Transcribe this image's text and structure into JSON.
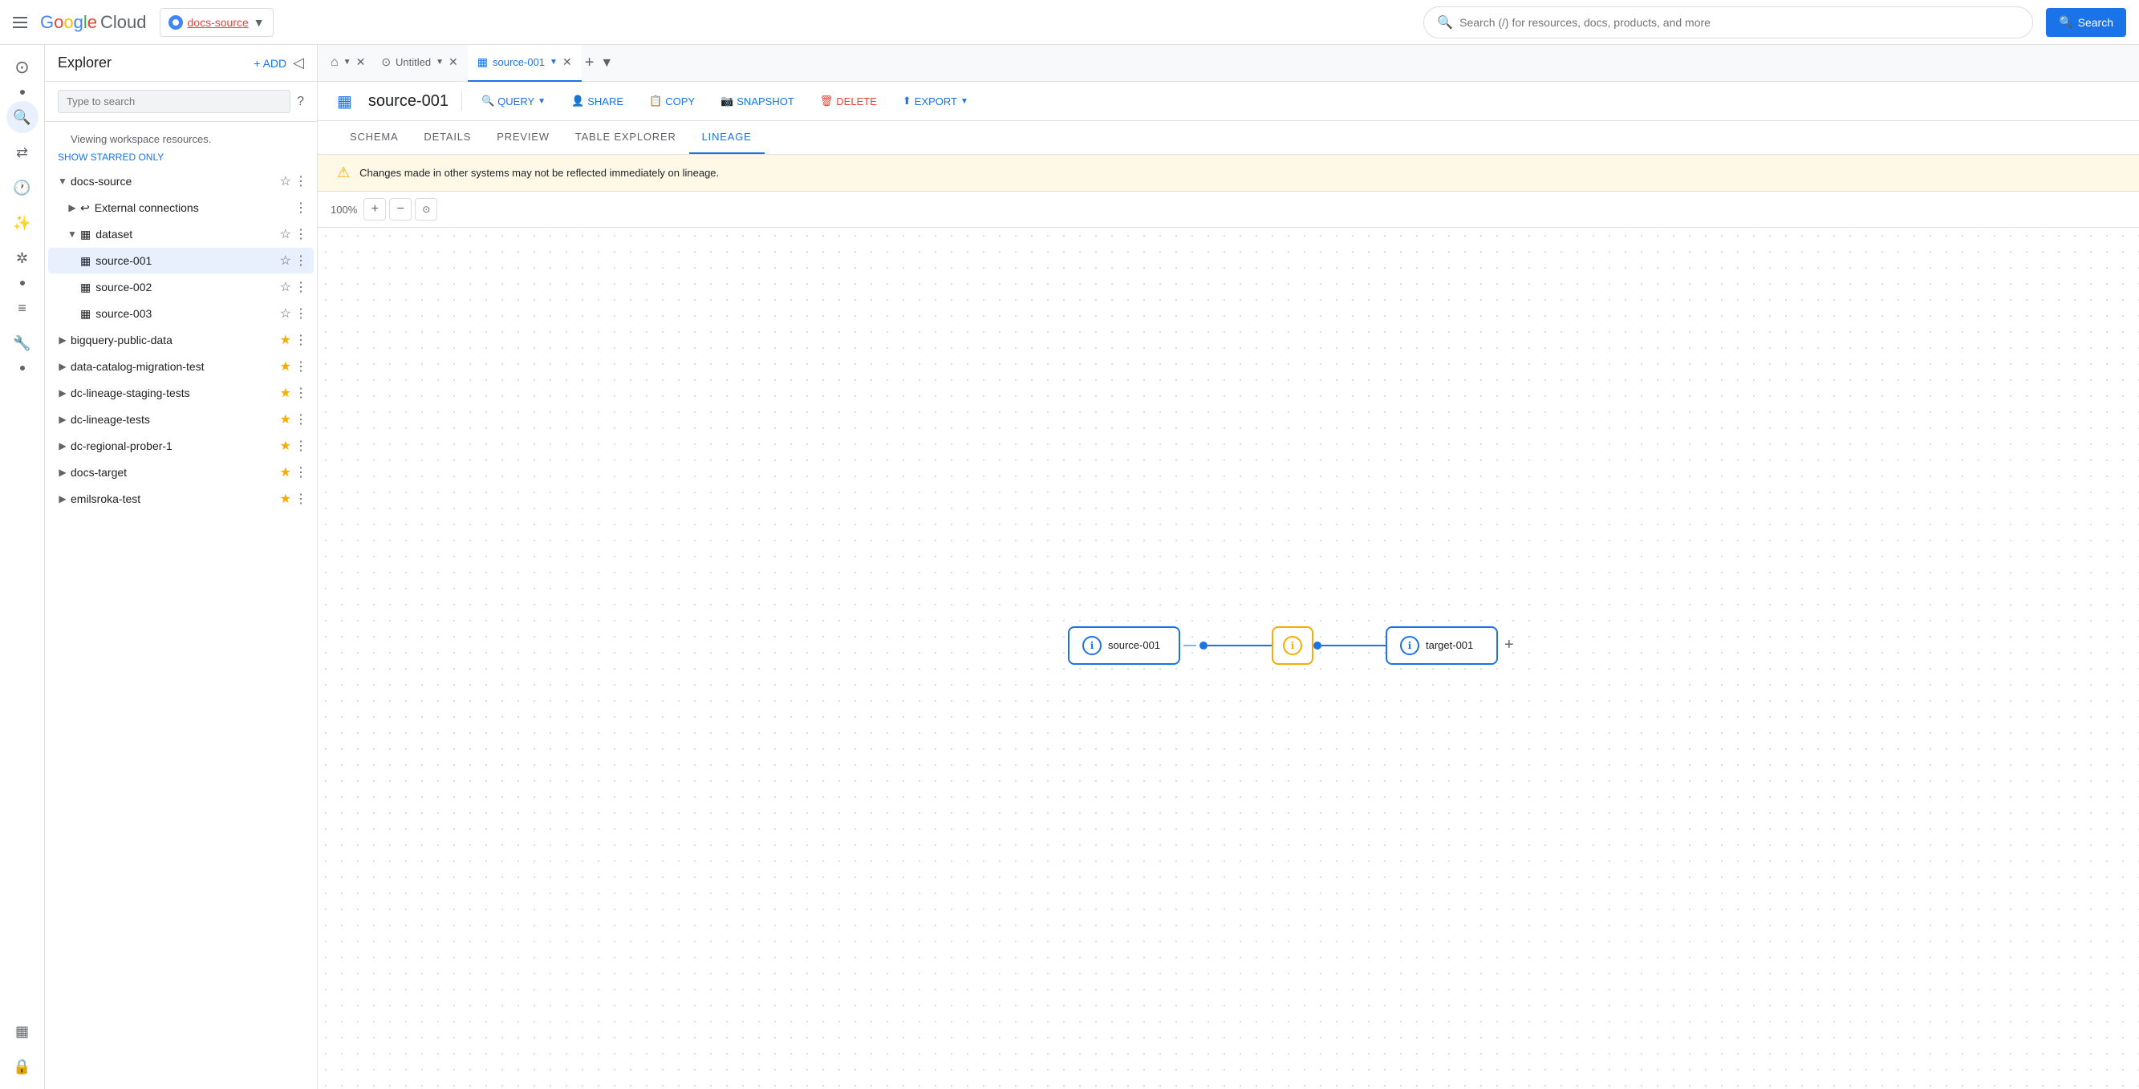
{
  "topbar": {
    "menu_icon": "hamburger",
    "logo_text": "Google Cloud",
    "project_name": "docs-source",
    "search_placeholder": "Search (/) for resources, docs, products, and more",
    "search_button_label": "Search"
  },
  "sidebar": {
    "title": "Explorer",
    "add_label": "+ ADD",
    "search_placeholder": "Type to search",
    "workspace_info": "Viewing workspace resources.",
    "show_starred_label": "SHOW STARRED ONLY",
    "tree": [
      {
        "id": "docs-source",
        "label": "docs-source",
        "level": 0,
        "icon": "▼",
        "starred": false,
        "type": "project"
      },
      {
        "id": "external-connections",
        "label": "External connections",
        "level": 1,
        "icon": "▶",
        "starred": false,
        "type": "external"
      },
      {
        "id": "dataset",
        "label": "dataset",
        "level": 1,
        "icon": "▼",
        "starred": false,
        "type": "dataset"
      },
      {
        "id": "source-001",
        "label": "source-001",
        "level": 2,
        "starred": false,
        "type": "table",
        "selected": true
      },
      {
        "id": "source-002",
        "label": "source-002",
        "level": 2,
        "starred": false,
        "type": "table"
      },
      {
        "id": "source-003",
        "label": "source-003",
        "level": 2,
        "starred": false,
        "type": "table"
      },
      {
        "id": "bigquery-public-data",
        "label": "bigquery-public-data",
        "level": 0,
        "icon": "▶",
        "starred": true,
        "type": "project"
      },
      {
        "id": "data-catalog-migration-test",
        "label": "data-catalog-migration-test",
        "level": 0,
        "icon": "▶",
        "starred": true,
        "type": "project"
      },
      {
        "id": "dc-lineage-staging-tests",
        "label": "dc-lineage-staging-tests",
        "level": 0,
        "icon": "▶",
        "starred": true,
        "type": "project"
      },
      {
        "id": "dc-lineage-tests",
        "label": "dc-lineage-tests",
        "level": 0,
        "icon": "▶",
        "starred": true,
        "type": "project"
      },
      {
        "id": "dc-regional-prober-1",
        "label": "dc-regional-prober-1",
        "level": 0,
        "icon": "▶",
        "starred": true,
        "type": "project"
      },
      {
        "id": "docs-target",
        "label": "docs-target",
        "level": 0,
        "icon": "▶",
        "starred": true,
        "type": "project"
      },
      {
        "id": "emilsroka-test",
        "label": "emilsroka-test",
        "level": 0,
        "icon": "▶",
        "starred": true,
        "type": "project"
      }
    ]
  },
  "tabs": [
    {
      "id": "home",
      "label": "",
      "type": "home",
      "closeable": false
    },
    {
      "id": "untitled",
      "label": "Untitled",
      "type": "query",
      "closeable": true,
      "active": false
    },
    {
      "id": "source-001-tab",
      "label": "source-001",
      "type": "table",
      "closeable": true,
      "active": true
    }
  ],
  "toolbar": {
    "table_icon": "☰",
    "table_name": "source-001",
    "query_label": "QUERY",
    "share_label": "SHARE",
    "copy_label": "COPY",
    "snapshot_label": "SNAPSHOT",
    "delete_label": "DELETE",
    "export_label": "EXPORT"
  },
  "sub_tabs": [
    {
      "id": "schema",
      "label": "SCHEMA"
    },
    {
      "id": "details",
      "label": "DETAILS"
    },
    {
      "id": "preview",
      "label": "PREVIEW"
    },
    {
      "id": "table-explorer",
      "label": "TABLE EXPLORER"
    },
    {
      "id": "lineage",
      "label": "LINEAGE",
      "active": true
    }
  ],
  "warning": {
    "message": "Changes made in other systems may not be reflected immediately on lineage."
  },
  "zoom": {
    "level": "100%"
  },
  "lineage": {
    "nodes": [
      {
        "id": "source-001-node",
        "label": "source-001",
        "type": "blue"
      },
      {
        "id": "middle-node",
        "label": "",
        "type": "orange"
      },
      {
        "id": "target-001-node",
        "label": "target-001",
        "type": "blue"
      }
    ]
  }
}
